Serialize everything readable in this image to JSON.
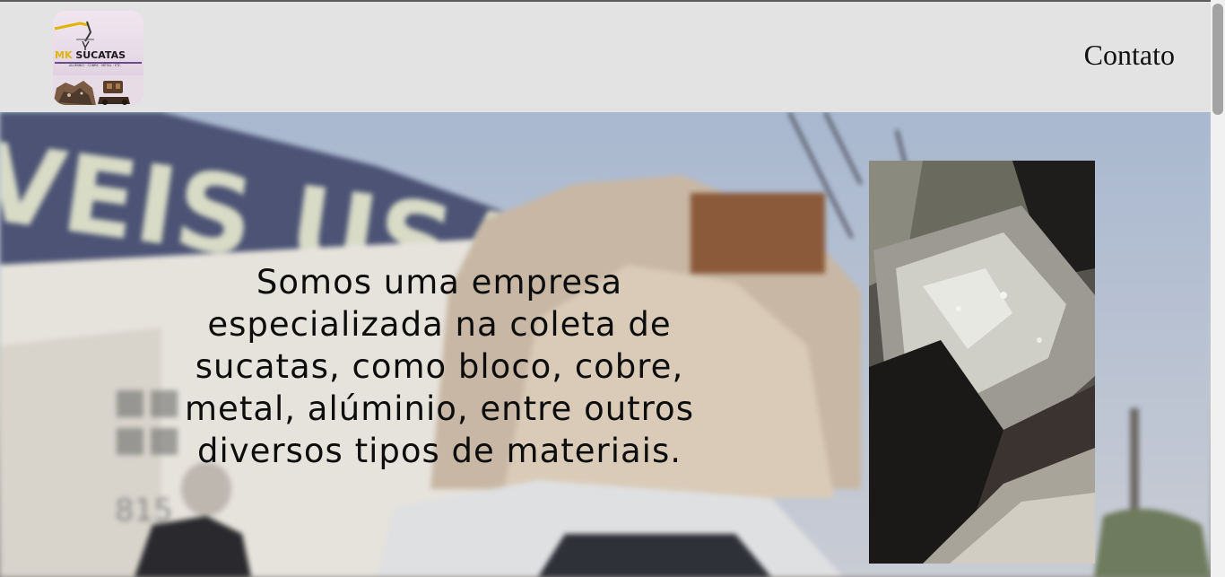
{
  "header": {
    "logo": {
      "brand_prefix": "MK",
      "brand_name": "SUCATAS",
      "tagline": "ALUMINIO · COBRE · METAL · ETC",
      "accent_color": "#e0b400"
    },
    "nav": {
      "contact_label": "Contato"
    }
  },
  "hero": {
    "headline": "Somos uma empresa especializada na coleta de sucatas, como bloco, cobre, metal, alúminio, entre outros diversos tipos de materiais.",
    "background_sign_text": "VEIS USAD",
    "background_house_number": "815"
  },
  "colors": {
    "header_bg": "#e3e3e3",
    "text": "#0d0d0d"
  }
}
